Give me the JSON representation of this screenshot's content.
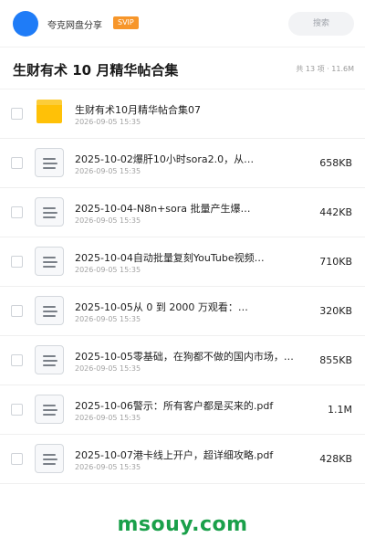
{
  "header": {
    "username": "夸克网盘分享",
    "badge": "SVIP",
    "search_placeholder": "搜索"
  },
  "title_bar": {
    "title": "生财有术 10 月精华帖合集",
    "meta": "共 13 项 · 11.6M"
  },
  "files": [
    {
      "type": "folder",
      "name": "生财有术10月精华帖合集07",
      "date": "2026-09-05 15:35",
      "size": ""
    },
    {
      "type": "doc",
      "name": "2025-10-02爆肝10小时sora2.0，从…",
      "date": "2026-09-05 15:35",
      "size": "658KB"
    },
    {
      "type": "doc",
      "name": "2025-10-04-N8n+sora 批量产生爆…",
      "date": "2026-09-05 15:35",
      "size": "442KB"
    },
    {
      "type": "doc",
      "name": "2025-10-04自动批量复刻YouTube视频…",
      "date": "2026-09-05 15:35",
      "size": "710KB"
    },
    {
      "type": "doc",
      "name": "2025-10-05从 0 到 2000 万观看：…",
      "date": "2026-09-05 15:35",
      "size": "320KB"
    },
    {
      "type": "doc",
      "name": "2025-10-05零基础，在狗都不做的国内市场，…",
      "date": "2026-09-05 15:35",
      "size": "855KB"
    },
    {
      "type": "doc",
      "name": "2025-10-06警示：所有客户都是买来的.pdf",
      "date": "2026-09-05 15:35",
      "size": "1.1M"
    },
    {
      "type": "doc",
      "name": "2025-10-07港卡线上开户，超详细攻略.pdf",
      "date": "2026-09-05 15:35",
      "size": "428KB"
    }
  ],
  "watermark": "msouy.com",
  "colors": {
    "accent": "#1f7cf7",
    "badge": "#f7962a",
    "folder": "#ffc107",
    "watermark": "#1aa04a"
  }
}
